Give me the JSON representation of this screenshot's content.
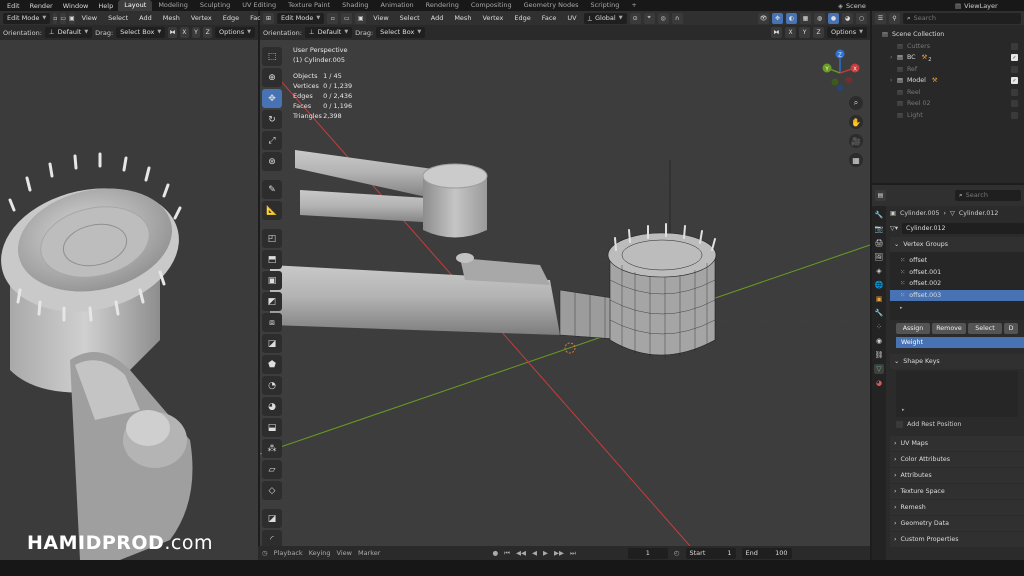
{
  "menu": {
    "items": [
      "Edit",
      "Render",
      "Window",
      "Help"
    ],
    "workspaces": [
      "Layout",
      "Modeling",
      "Sculpting",
      "UV Editing",
      "Texture Paint",
      "Shading",
      "Animation",
      "Rendering",
      "Compositing",
      "Geometry Nodes",
      "Scripting"
    ],
    "active_workspace": "Layout",
    "scene": "Scene",
    "view_layer": "ViewLayer"
  },
  "left_header": {
    "mode": "Edit Mode",
    "menus": [
      "View",
      "Select",
      "Add",
      "Mesh",
      "Vertex",
      "Edge",
      "Face"
    ],
    "orientation_label": "Orientation:",
    "orientation_value": "Default",
    "drag_label": "Drag:",
    "drag_value": "Select Box",
    "axes": [
      "X",
      "Y",
      "Z"
    ],
    "options": "Options"
  },
  "main_header": {
    "mode": "Edit Mode",
    "menus": [
      "View",
      "Select",
      "Add",
      "Mesh",
      "Vertex",
      "Edge",
      "Face",
      "UV"
    ],
    "transform": "Global",
    "orientation_label": "Orientation:",
    "orientation_value": "Default",
    "drag_label": "Drag:",
    "drag_value": "Select Box",
    "axes": [
      "X",
      "Y",
      "Z"
    ],
    "options": "Options"
  },
  "viewport": {
    "view_name": "User Perspective",
    "object_name": "(1) Cylinder.005",
    "stats": [
      {
        "label": "Objects",
        "value": "1 / 45"
      },
      {
        "label": "Vertices",
        "value": "0 / 1,239"
      },
      {
        "label": "Edges",
        "value": "0 / 2,436"
      },
      {
        "label": "Faces",
        "value": "0 / 1,196"
      },
      {
        "label": "Triangles",
        "value": "2,398"
      }
    ]
  },
  "gizmo": {
    "x": "X",
    "y": "Y",
    "z": "Z"
  },
  "timeline": {
    "playback": "Playback",
    "keying": "Keying",
    "view": "View",
    "marker": "Marker",
    "current_frame": "1",
    "start_label": "Start",
    "start": "1",
    "end_label": "End",
    "end": "100"
  },
  "outliner": {
    "search_placeholder": "Search",
    "root": "Scene Collection",
    "items": [
      {
        "name": "Cutters",
        "dim": true,
        "checked": false,
        "badge": ""
      },
      {
        "name": "BC",
        "dim": false,
        "checked": true,
        "badge": "2"
      },
      {
        "name": "Ref",
        "dim": true,
        "checked": false,
        "badge": ""
      },
      {
        "name": "Model",
        "dim": false,
        "checked": true,
        "badge": ""
      },
      {
        "name": "Reel",
        "dim": true,
        "checked": false,
        "badge": ""
      },
      {
        "name": "Reel 02",
        "dim": true,
        "checked": false,
        "badge": ""
      },
      {
        "name": "Light",
        "dim": true,
        "checked": false,
        "badge": ""
      }
    ]
  },
  "properties": {
    "search_placeholder": "Search",
    "breadcrumb_object": "Cylinder.005",
    "breadcrumb_mesh": "Cylinder.012",
    "mesh_name": "Cylinder.012",
    "vertex_groups_title": "Vertex Groups",
    "vertex_groups": [
      {
        "name": "offset",
        "selected": false
      },
      {
        "name": "offset.001",
        "selected": false
      },
      {
        "name": "offset.002",
        "selected": false
      },
      {
        "name": "offset.003",
        "selected": true
      }
    ],
    "buttons": [
      "Assign",
      "Remove",
      "Select",
      "D"
    ],
    "weight_label": "Weight",
    "shape_keys_title": "Shape Keys",
    "add_rest_position": "Add Rest Position",
    "sections": [
      "UV Maps",
      "Color Attributes",
      "Attributes",
      "Texture Space",
      "Remesh",
      "Geometry Data",
      "Custom Properties"
    ]
  },
  "watermark": {
    "brand": "HAMIDPROD",
    "tld": ".com"
  },
  "colors": {
    "accent": "#4772b3",
    "x_axis": "#c83c3c",
    "y_axis": "#6a9c22",
    "z_axis": "#2f72d6"
  }
}
